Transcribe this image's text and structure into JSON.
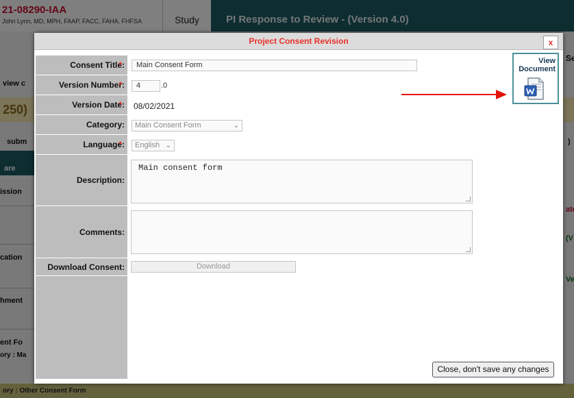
{
  "background": {
    "protocol_id": "21-08290-IAA",
    "investigator": "John Lynn, MD, MPH, FAAP, FACC, FAHA, FHFSA",
    "study_tab": "Study",
    "page_title": "PI Response to Review - (Version 4.0)",
    "fragments": {
      "view_c": "view c",
      "n250": "250)",
      "subm": "subm",
      "are": "are",
      "ission": "ission",
      "cation": "cation",
      "hment": "hment",
      "ent_fo": "ent Fo",
      "ory_ma": "ory : Ma",
      "se": "Se",
      "ate": "ate",
      "v": "(V",
      "ver": "Ver",
      "paren": ")"
    },
    "footer_text": "ory : Other Consent Form"
  },
  "modal": {
    "title": "Project Consent Revision",
    "close_x": "x",
    "fields": {
      "consent_title": {
        "label": "Consent Title:",
        "value": "Main Consent Form",
        "required": "*"
      },
      "version_number": {
        "label": "Version Number:",
        "value": "4",
        "suffix": ".0",
        "required": "*"
      },
      "version_date": {
        "label": "Version Date:",
        "value": "08/02/2021",
        "required": "*"
      },
      "category": {
        "label": "Category:",
        "value": "Main Consent Form"
      },
      "language": {
        "label": "Language:",
        "value": "English",
        "required": "* "
      },
      "description": {
        "label": "Description:",
        "value": "Main consent form"
      },
      "comments": {
        "label": "Comments:",
        "value": ""
      },
      "download_consent": {
        "label": "Download Consent:",
        "button": "Download"
      }
    },
    "view_document": {
      "line1": "View",
      "line2": "Document",
      "icon": "word-document-icon"
    },
    "close_button": "Close, don't save any changes"
  },
  "colors": {
    "accent_red": "#e8312a",
    "header_teal": "#1a5a63",
    "label_gray": "#bdbdbd",
    "arrow_red": "#e3120b"
  }
}
